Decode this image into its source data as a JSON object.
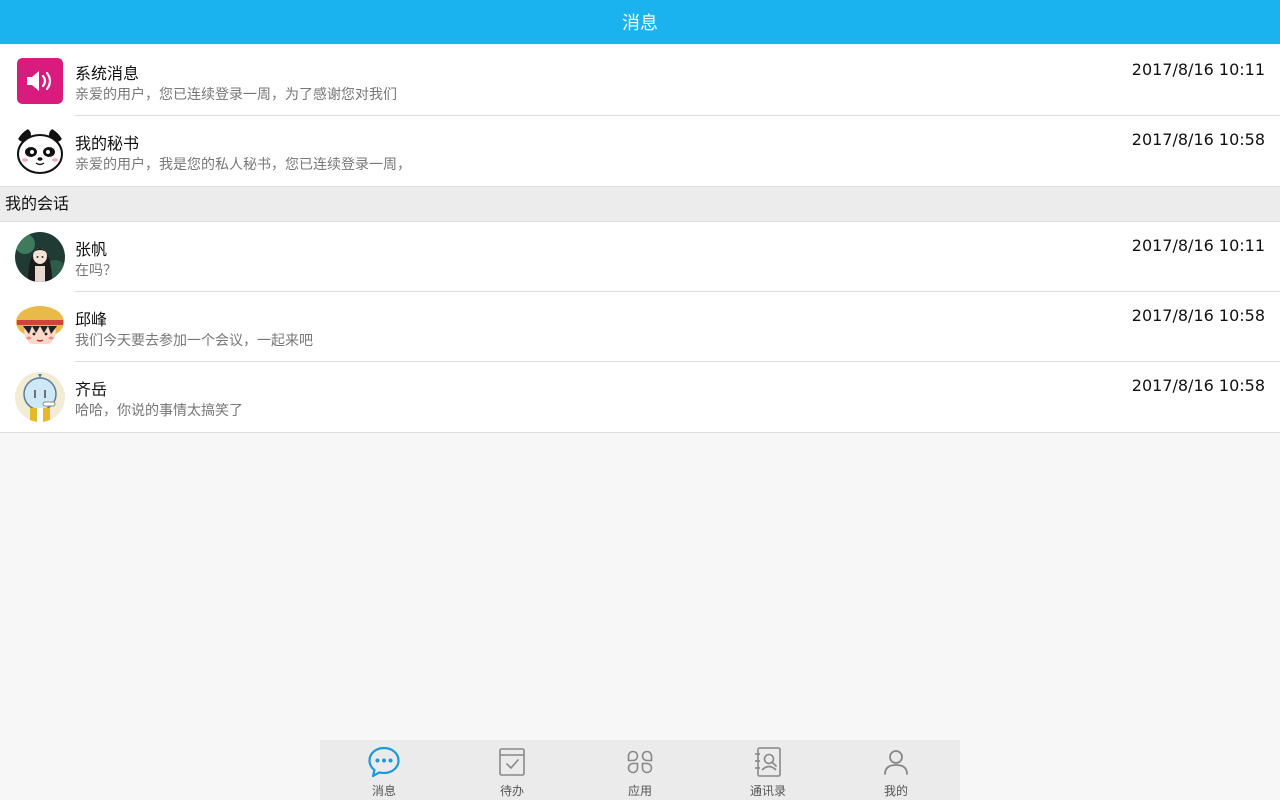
{
  "header": {
    "title": "消息"
  },
  "system_messages": [
    {
      "name": "系统消息",
      "preview": "亲爱的用户，您已连续登录一周，为了感谢您对我们",
      "time": "2017/8/16 10:11",
      "icon": "speaker-icon"
    },
    {
      "name": "我的秘书",
      "preview": "亲爱的用户，我是您的私人秘书，您已连续登录一周，",
      "time": "2017/8/16 10:58",
      "icon": "panda-avatar"
    }
  ],
  "section": {
    "title": "我的会话"
  },
  "conversations": [
    {
      "name": "张帆",
      "preview": "在吗？",
      "time": "2017/8/16 10:11"
    },
    {
      "name": "邱峰",
      "preview": "我们今天要去参加一个会议，一起来吧",
      "time": "2017/8/16 10:58"
    },
    {
      "name": "齐岳",
      "preview": "哈哈，你说的事情太搞笑了",
      "time": "2017/8/16 10:58"
    }
  ],
  "tabbar": {
    "active": "消息",
    "tabs": [
      {
        "label": "消息",
        "icon": "chat-bubble-icon"
      },
      {
        "label": "待办",
        "icon": "todo-check-icon"
      },
      {
        "label": "应用",
        "icon": "apps-grid-icon"
      },
      {
        "label": "通讯录",
        "icon": "contacts-book-icon"
      },
      {
        "label": "我的",
        "icon": "person-icon"
      }
    ]
  },
  "colors": {
    "header": "#1ab3ef",
    "system_icon": "#d81b7c",
    "tab_active": "#1a9bd6",
    "tab_inactive": "#888888"
  }
}
